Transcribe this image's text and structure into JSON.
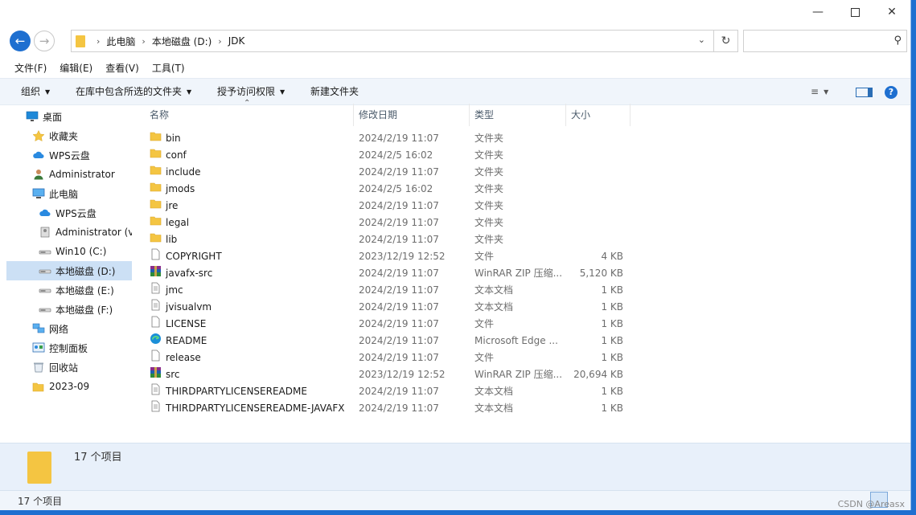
{
  "window": {
    "minimize_icon": "minimize",
    "maximize_icon": "maximize",
    "close_icon": "close"
  },
  "address": {
    "crumbs": [
      "此电脑",
      "本地磁盘 (D:)",
      "JDK"
    ],
    "search_placeholder": ""
  },
  "menu": [
    "文件(F)",
    "编辑(E)",
    "查看(V)",
    "工具(T)"
  ],
  "toolbar": {
    "organize": "组织",
    "include_library": "在库中包含所选的文件夹",
    "share": "授予访问权限",
    "new_folder": "新建文件夹"
  },
  "sidebar": [
    {
      "label": "桌面",
      "icon": "desktop-icon",
      "indent": 0
    },
    {
      "label": "收藏夹",
      "icon": "star-icon",
      "indent": 1
    },
    {
      "label": "WPS云盘",
      "icon": "cloud-icon",
      "indent": 1
    },
    {
      "label": "Administrator",
      "icon": "user-icon",
      "indent": 1
    },
    {
      "label": "此电脑",
      "icon": "computer-icon",
      "indent": 1
    },
    {
      "label": "WPS云盘",
      "icon": "cloud-icon",
      "indent": 2
    },
    {
      "label": "Administrator (vi",
      "icon": "user-drive-icon",
      "indent": 2
    },
    {
      "label": "Win10 (C:)",
      "icon": "drive-icon",
      "indent": 2
    },
    {
      "label": "本地磁盘 (D:)",
      "icon": "drive-icon",
      "indent": 2,
      "selected": true
    },
    {
      "label": "本地磁盘 (E:)",
      "icon": "drive-icon",
      "indent": 2
    },
    {
      "label": "本地磁盘 (F:)",
      "icon": "drive-icon",
      "indent": 2
    },
    {
      "label": "网络",
      "icon": "network-icon",
      "indent": 1
    },
    {
      "label": "控制面板",
      "icon": "control-panel-icon",
      "indent": 1
    },
    {
      "label": "回收站",
      "icon": "recycle-bin-icon",
      "indent": 1
    },
    {
      "label": "2023-09",
      "icon": "folder-icon",
      "indent": 1
    }
  ],
  "columns": {
    "name": "名称",
    "date": "修改日期",
    "type": "类型",
    "size": "大小"
  },
  "files": [
    {
      "name": "bin",
      "date": "2024/2/19 11:07",
      "type": "文件夹",
      "size": "",
      "icon": "folder-icon"
    },
    {
      "name": "conf",
      "date": "2024/2/5 16:02",
      "type": "文件夹",
      "size": "",
      "icon": "folder-icon"
    },
    {
      "name": "include",
      "date": "2024/2/19 11:07",
      "type": "文件夹",
      "size": "",
      "icon": "folder-icon"
    },
    {
      "name": "jmods",
      "date": "2024/2/5 16:02",
      "type": "文件夹",
      "size": "",
      "icon": "folder-icon"
    },
    {
      "name": "jre",
      "date": "2024/2/19 11:07",
      "type": "文件夹",
      "size": "",
      "icon": "folder-icon"
    },
    {
      "name": "legal",
      "date": "2024/2/19 11:07",
      "type": "文件夹",
      "size": "",
      "icon": "folder-icon"
    },
    {
      "name": "lib",
      "date": "2024/2/19 11:07",
      "type": "文件夹",
      "size": "",
      "icon": "folder-icon"
    },
    {
      "name": "COPYRIGHT",
      "date": "2023/12/19 12:52",
      "type": "文件",
      "size": "4 KB",
      "icon": "file-icon"
    },
    {
      "name": "javafx-src",
      "date": "2024/2/19 11:07",
      "type": "WinRAR ZIP 压缩...",
      "size": "5,120 KB",
      "icon": "winrar-icon"
    },
    {
      "name": "jmc",
      "date": "2024/2/19 11:07",
      "type": "文本文档",
      "size": "1 KB",
      "icon": "text-file-icon"
    },
    {
      "name": "jvisualvm",
      "date": "2024/2/19 11:07",
      "type": "文本文档",
      "size": "1 KB",
      "icon": "text-file-icon"
    },
    {
      "name": "LICENSE",
      "date": "2024/2/19 11:07",
      "type": "文件",
      "size": "1 KB",
      "icon": "file-icon"
    },
    {
      "name": "README",
      "date": "2024/2/19 11:07",
      "type": "Microsoft Edge ...",
      "size": "1 KB",
      "icon": "edge-icon"
    },
    {
      "name": "release",
      "date": "2024/2/19 11:07",
      "type": "文件",
      "size": "1 KB",
      "icon": "file-icon"
    },
    {
      "name": "src",
      "date": "2023/12/19 12:52",
      "type": "WinRAR ZIP 压缩...",
      "size": "20,694 KB",
      "icon": "winrar-icon"
    },
    {
      "name": "THIRDPARTYLICENSEREADME",
      "date": "2024/2/19 11:07",
      "type": "文本文档",
      "size": "1 KB",
      "icon": "text-file-icon"
    },
    {
      "name": "THIRDPARTYLICENSEREADME-JAVAFX",
      "date": "2024/2/19 11:07",
      "type": "文本文档",
      "size": "1 KB",
      "icon": "text-file-icon"
    }
  ],
  "details": {
    "count": "17 个项目"
  },
  "status": {
    "count": "17 个项目"
  },
  "watermark": "CSDN @Areasx",
  "colors": {
    "accent": "#1e6fd0",
    "folder": "#f4c542",
    "selection": "#cce0f5",
    "toolbar_bg": "#f0f5fb"
  }
}
